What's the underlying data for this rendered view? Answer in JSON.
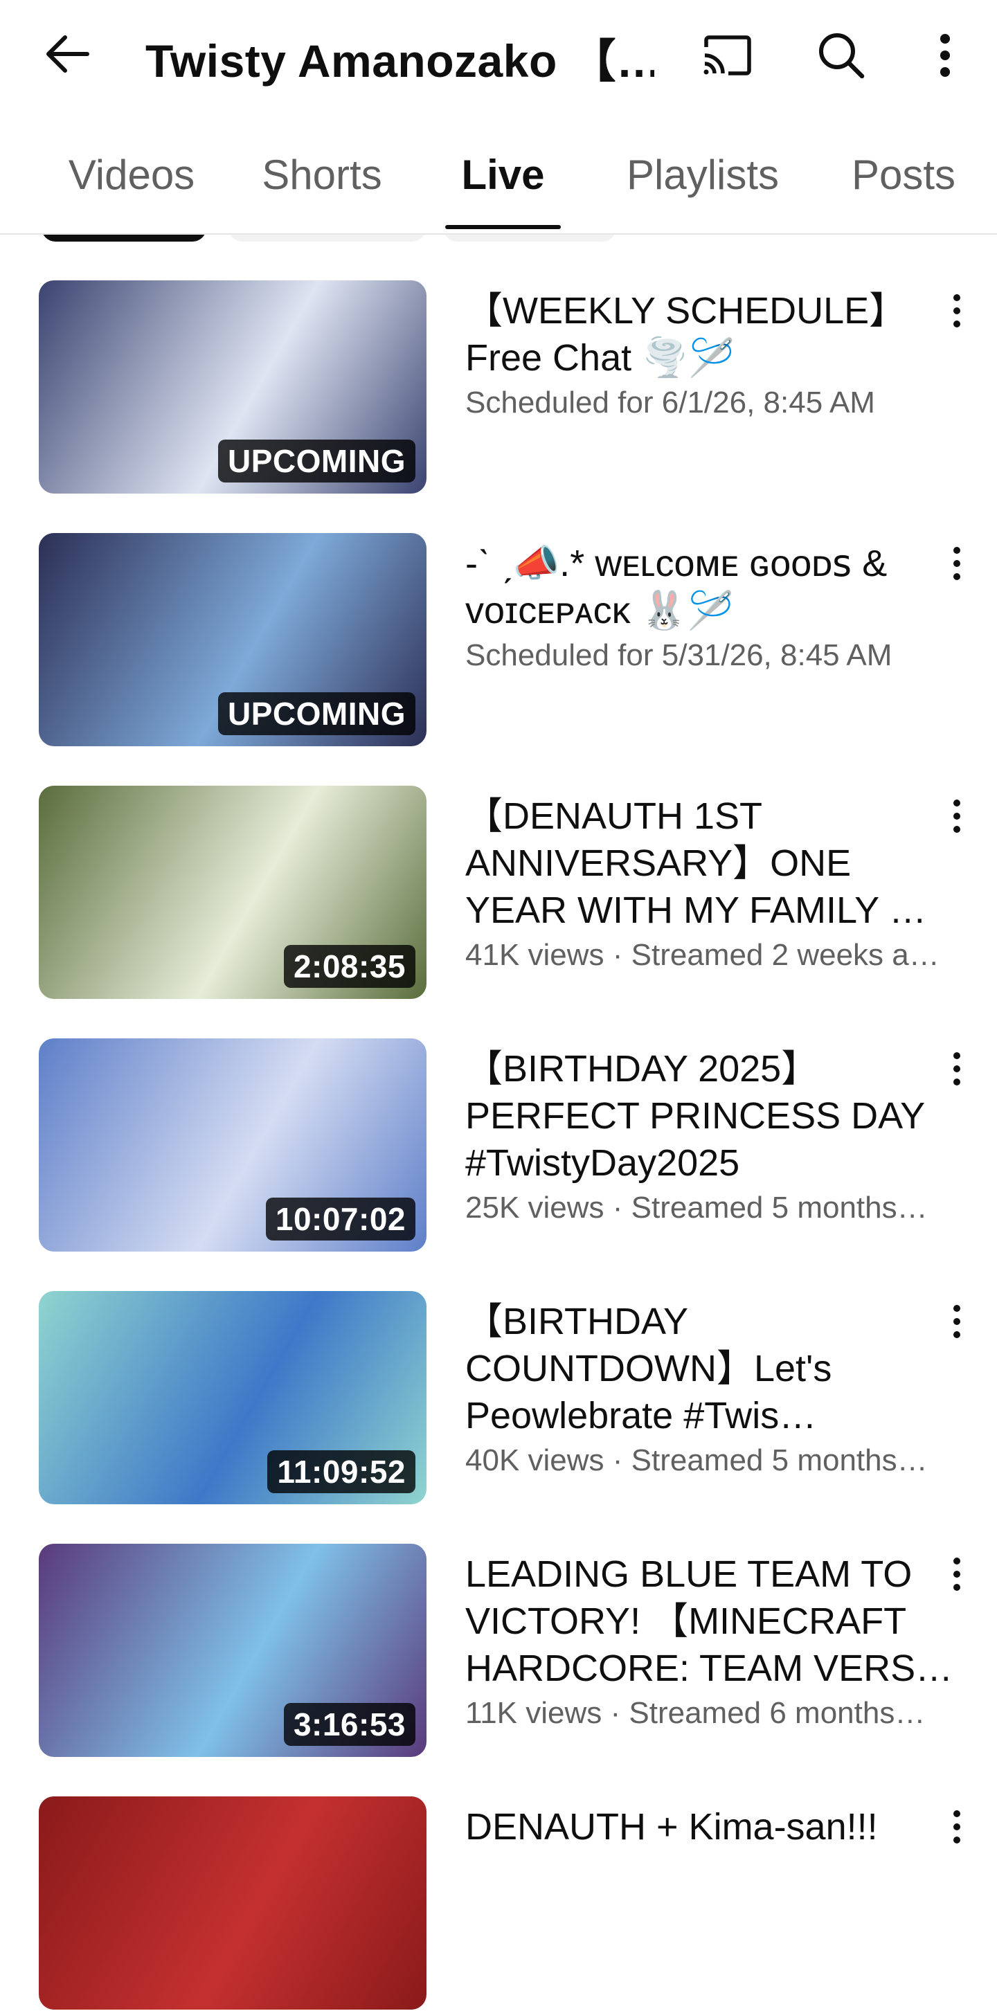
{
  "header": {
    "channel_title": "Twisty Amanozako 【…",
    "back_icon": "arrow-left-icon",
    "cast_icon": "cast-icon",
    "search_icon": "search-icon",
    "more_icon": "more-vertical-icon"
  },
  "tabs": [
    {
      "label": "Videos",
      "active": false
    },
    {
      "label": "Shorts",
      "active": false
    },
    {
      "label": "Live",
      "active": true
    },
    {
      "label": "Playlists",
      "active": false
    },
    {
      "label": "Posts",
      "active": false
    }
  ],
  "videos": [
    {
      "title": "【WEEKLY SCHEDULE】Free Chat 🌪️🪡",
      "meta": "Scheduled for 6/1/26, 8:45 AM",
      "badge": "UPCOMING",
      "thumb_colors": [
        "#3a4470",
        "#dfe4f2"
      ]
    },
    {
      "title": "-ˋ ˏ📣.* ᴡᴇʟᴄᴏᴍᴇ ɢᴏᴏᴅꜱ & ᴠᴏɪᴄᴇᴘᴀᴄᴋ 🐰🪡",
      "meta": "Scheduled for 5/31/26, 8:45 AM",
      "badge": "UPCOMING",
      "thumb_colors": [
        "#2c2f55",
        "#7ea9d8"
      ]
    },
    {
      "title": "【DENAUTH 1ST ANNIVERSARY】ONE YEAR WITH MY FAMILY …",
      "meta": "41K views · Streamed 2 weeks a…",
      "badge": "2:08:35",
      "thumb_colors": [
        "#5a6d3c",
        "#e6ecd8"
      ]
    },
    {
      "title": "【BIRTHDAY 2025】PERFECT PRINCESS DAY #TwistyDay2025",
      "meta": "25K views · Streamed 5 months…",
      "badge": "10:07:02",
      "thumb_colors": [
        "#5e7fc8",
        "#d4dcf2"
      ]
    },
    {
      "title": "【BIRTHDAY COUNTDOWN】Let's Peowlebrate #Twis…",
      "meta": "40K views · Streamed 5 months…",
      "badge": "11:09:52",
      "thumb_colors": [
        "#8fd4cf",
        "#3f78c8"
      ]
    },
    {
      "title": "LEADING BLUE TEAM TO VICTORY! 【MINECRAFT HARDCORE: TEAM VERS…",
      "meta": "11K views · Streamed 6 months…",
      "badge": "3:16:53",
      "thumb_colors": [
        "#5a3a7a",
        "#7fc0e8"
      ]
    },
    {
      "title": "DENAUTH + Kima-san!!!",
      "meta": "",
      "badge": "",
      "thumb_colors": [
        "#8a1a1a",
        "#c43030"
      ]
    }
  ]
}
